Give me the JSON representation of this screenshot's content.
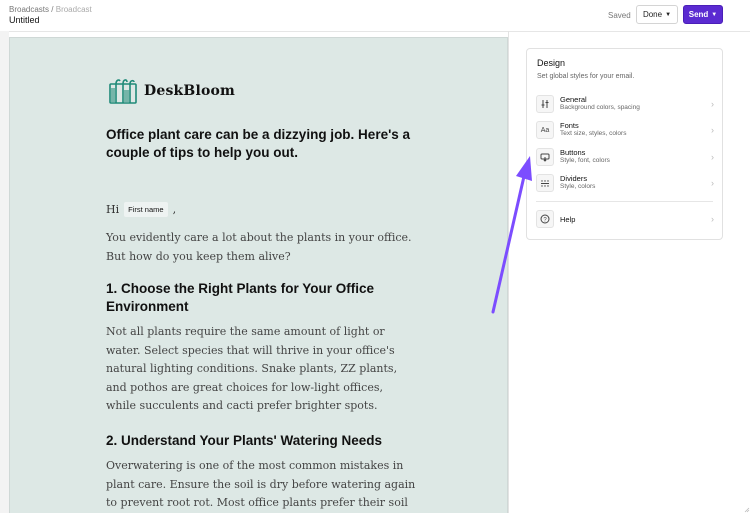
{
  "header": {
    "breadcrumb_root": "Broadcasts",
    "breadcrumb_sep": "/",
    "breadcrumb_current": "Broadcast",
    "title": "Untitled",
    "status": "Saved",
    "done_label": "Done",
    "send_label": "Send"
  },
  "email": {
    "brand": "DeskBloom",
    "headline": "Office plant care can be a dizzying job. Here's a couple of tips to help you out.",
    "greeting": "Hi",
    "first_name_tag": "First name",
    "greeting_end": ",",
    "intro": "You evidently care a lot about the plants in your office. But how do you keep them alive?",
    "h1": "1. Choose the Right Plants for Your Office Environment",
    "p1": "Not all plants require the same amount of light or water. Select species that will thrive in your office's natural lighting conditions. Snake plants, ZZ plants, and pothos are great choices for low-light offices, while succulents and cacti prefer brighter spots.",
    "h2": "2. Understand Your Plants' Watering Needs",
    "p2": "Overwatering is one of the most common mistakes in plant care. Ensure the soil is dry before watering again to prevent root rot. Most office plants prefer their soil to be"
  },
  "design_panel": {
    "title": "Design",
    "subtitle": "Set global styles for your email.",
    "items": [
      {
        "label": "General",
        "sub": "Background colors, spacing",
        "icon": "sliders-icon"
      },
      {
        "label": "Fonts",
        "sub": "Text size, styles, colors",
        "icon": "font-icon"
      },
      {
        "label": "Buttons",
        "sub": "Style, font, colors",
        "icon": "button-icon"
      },
      {
        "label": "Dividers",
        "sub": "Style, colors",
        "icon": "divider-icon"
      }
    ],
    "help_label": "Help",
    "font_icon_text": "Aa"
  },
  "colors": {
    "accent": "#5b2bd1",
    "email_bg": "#dde8e5",
    "arrow": "#7c4dff",
    "logo": "#1f8a78"
  }
}
